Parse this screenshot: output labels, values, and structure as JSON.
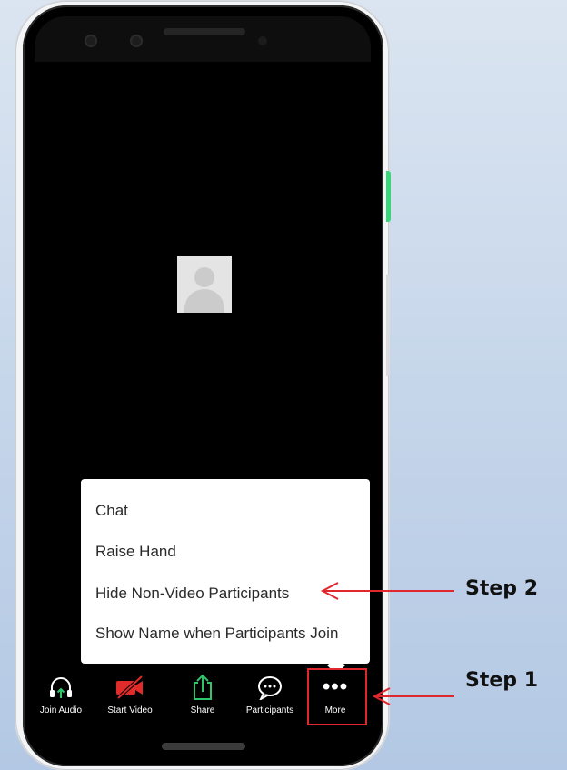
{
  "menu": {
    "items": [
      {
        "label": "Chat"
      },
      {
        "label": "Raise Hand"
      },
      {
        "label": "Hide Non-Video Participants"
      },
      {
        "label": "Show Name when Participants Join"
      }
    ]
  },
  "toolbar": {
    "buttons": [
      {
        "label": "Join Audio",
        "icon": "headphones-icon"
      },
      {
        "label": "Start Video",
        "icon": "video-off-icon"
      },
      {
        "label": "Share",
        "icon": "share-icon"
      },
      {
        "label": "Participants",
        "icon": "chat-bubble-icon"
      },
      {
        "label": "More",
        "icon": "more-dots-icon",
        "glyph": "•••"
      }
    ]
  },
  "annotations": {
    "step1": "Step 1",
    "step2": "Step 2",
    "color": "#e0272d"
  },
  "colors": {
    "accent_green": "#2ec56d",
    "video_off_red": "#e02b2b",
    "screen_bg": "#000000"
  }
}
